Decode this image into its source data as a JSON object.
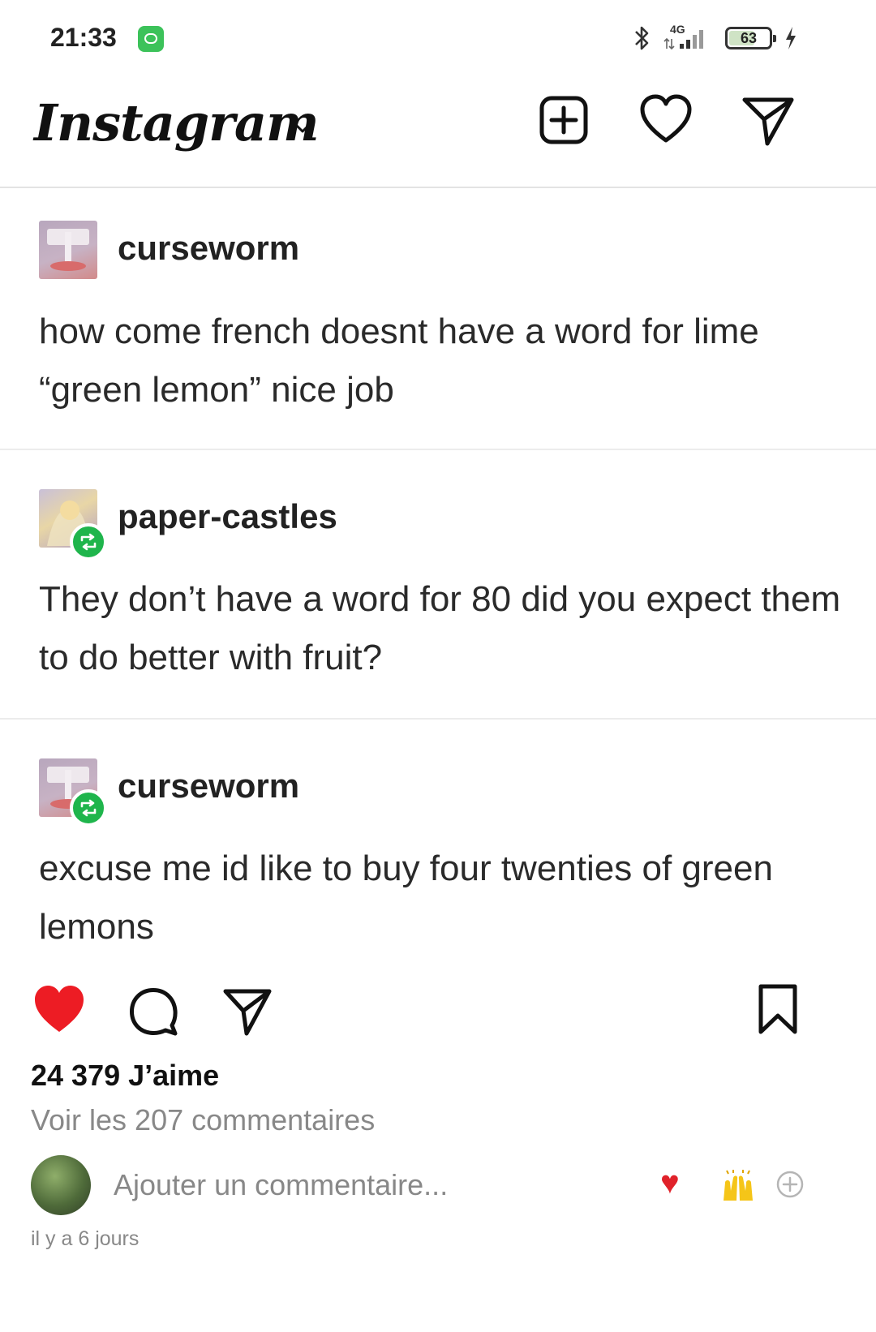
{
  "status_bar": {
    "time": "21:33",
    "network": "4G",
    "battery": "63"
  },
  "header": {
    "brand": "Instagram"
  },
  "posts": [
    {
      "username": "curseworm",
      "text": "how come french doesnt have a word for lime “green lemon” nice job",
      "reblog": false
    },
    {
      "username": "paper-castles",
      "text": "They don’t have a word for 80 did you expect them to do better with fruit?",
      "reblog": true
    },
    {
      "username": "curseworm",
      "text": "excuse me id like to buy four twenties of green lemons",
      "reblog": true
    }
  ],
  "engagement": {
    "likes": "24 379 J’aime",
    "view_comments": "Voir les 207 commentaires",
    "add_comment_placeholder": "Ajouter un commentaire...",
    "posted_ago": "il y a 6 jours"
  },
  "colors": {
    "like_red": "#ed1c24",
    "reblog_green": "#1fb54c",
    "muted_text": "#888888"
  },
  "icons": [
    "chevron-down-icon",
    "new-post-icon",
    "heart-outline-icon",
    "direct-message-icon",
    "heart-filled-icon",
    "comment-icon",
    "share-icon",
    "bookmark-icon",
    "raising-hands-icon",
    "add-circle-icon",
    "reblog-icon",
    "bluetooth-icon",
    "signal-icon",
    "battery-icon"
  ]
}
